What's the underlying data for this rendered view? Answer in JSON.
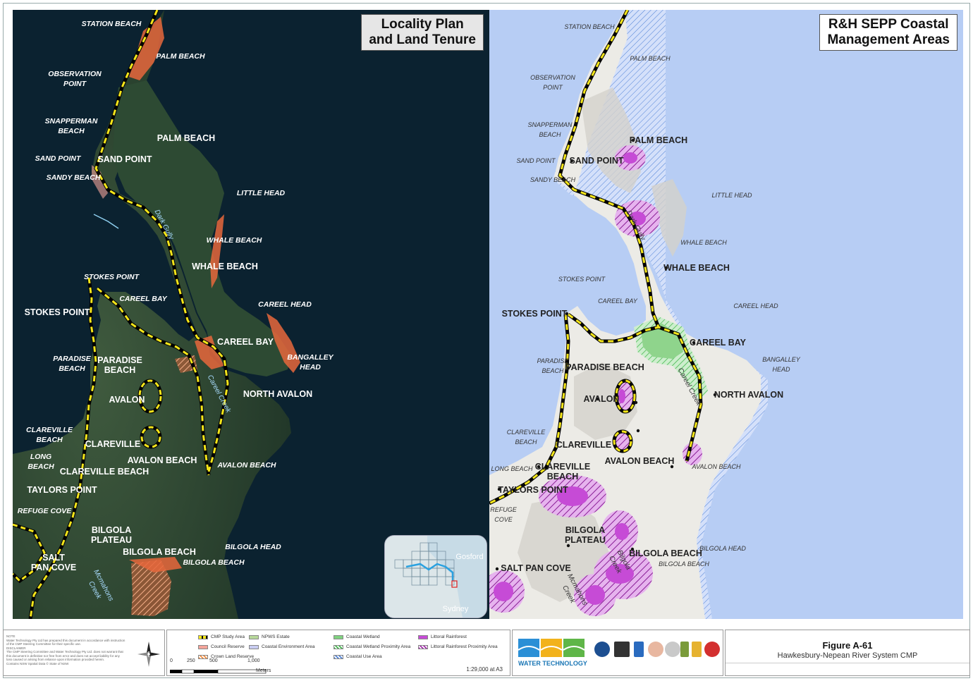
{
  "left_panel": {
    "title_line1": "Locality Plan",
    "title_line2": "and Land Tenure"
  },
  "right_panel": {
    "title_line1": "R&H SEPP Coastal",
    "title_line2": "Management Areas"
  },
  "labels": {
    "station_beach": "STATION BEACH",
    "palm_beach_beach": "PALM BEACH",
    "observation_point": "OBSERVATION\nPOINT",
    "snapperman_beach": "SNAPPERMAN\nBEACH",
    "palm_beach_locality": "PALM BEACH",
    "sand_point_beach": "SAND POINT",
    "sand_point_locality": "SAND POINT",
    "sandy_beach": "SANDY BEACH",
    "little_head": "LITTLE HEAD",
    "dark_gully": "Dark Gully",
    "whale_beach_beach": "WHALE BEACH",
    "whale_beach_locality": "WHALE BEACH",
    "stokes_point_small": "STOKES POINT",
    "careel_bay_small": "CAREEL BAY",
    "careel_head": "CAREEL HEAD",
    "stokes_point_locality": "STOKES POINT",
    "careel_bay_locality": "CAREEL BAY",
    "bangalley_head": "BANGALLEY\nHEAD",
    "paradise_beach_beach": "PARADISE\nBEACH",
    "paradise_beach_locality": "PARADISE\nBEACH",
    "paradise_beach_locality_right": "PARADISE BEACH",
    "careel_creek": "Careel Creek",
    "north_avalon": "NORTH AVALON",
    "avalon": "AVALON",
    "clareville_beach": "CLAREVILLE\nBEACH",
    "clareville_locality": "CLAREVILLE",
    "long_beach": "LONG\nBEACH",
    "long_beach_right": "LONG BEACH",
    "avalon_beach_locality": "AVALON BEACH",
    "avalon_beach_beach": "AVALON BEACH",
    "clareville_beach_locality": "CLAREVILLE BEACH",
    "clareville_beach_locality_right": "CLAREVILLE\nBEACH",
    "taylors_point": "TAYLORS POINT",
    "refuge_cove": "REFUGE COVE",
    "refuge_cove_right": "REFUGE\nCOVE",
    "bilgola_plateau": "BILGOLA\nPLATEAU",
    "bilgola_beach_locality": "BILGOLA BEACH",
    "bilgola_head": "BILGOLA HEAD",
    "bilgola_beach_beach": "BILGOLA BEACH",
    "salt_pan_cove": "SALT\nPAN COVE",
    "salt_pan_cove_right": "SALT PAN COVE",
    "mcmahons_creek": "Mcmahons\nCreek",
    "bilgola_creek": "Bilgola\nCreek"
  },
  "inset": {
    "gosford": "Gosford",
    "sydney": "Sydney"
  },
  "legend": {
    "items": [
      {
        "label": "CMP Study Area",
        "color": "#f5e61a",
        "style": "dashed"
      },
      {
        "label": "Council Reserve",
        "color": "#f4a49a",
        "style": "fill"
      },
      {
        "label": "Crown Land Reserve",
        "color": "#f08a3c",
        "style": "hatch"
      },
      {
        "label": "NPWS Estate",
        "color": "#b7d89a",
        "style": "fill"
      },
      {
        "label": "Coastal Environment Area",
        "color": "#c9cdf2",
        "style": "fill"
      },
      {
        "label": "Coastal Wetland",
        "color": "#7fd27f",
        "style": "fill"
      },
      {
        "label": "Coastal Wetland Proximity Area",
        "color": "#3fb64a",
        "style": "hatch"
      },
      {
        "label": "Coastal Use Area",
        "color": "#4c7fd6",
        "style": "hatch"
      },
      {
        "label": "Littoral Rainforest",
        "color": "#c64bd6",
        "style": "fill"
      },
      {
        "label": "Littoral Rainforest Proximity Area",
        "color": "#a02aa8",
        "style": "hatch"
      }
    ],
    "scale_ticks": [
      "0",
      "250",
      "500",
      "1,000"
    ],
    "scale_units": "Meters",
    "scale_ratio": "1:29,000 at A3"
  },
  "notes": {
    "note_heading": "NOTE",
    "note_text": "Water Technology Pty Ltd has prepared this document in accordance with instruction of the CMP Steering Committee for their specific use.",
    "disclaimer_heading": "DISCLAIMER",
    "disclaimer_text": "The CMP Steering Committee and Water Technology Pty Ltd. does not warrant that this document is definitive nor free from error and does not accept liability for any loss caused or arising from reliance upon information provided herein.",
    "contains": "Contains NSW Spatial Data © State of NSW"
  },
  "logos": {
    "water_technology": "WATER TECHNOLOGY"
  },
  "figure": {
    "title": "Figure A-61",
    "subtitle": "Hawkesbury-Nepean River System CMP"
  },
  "colors": {
    "ocean_dark": "#0b2230",
    "land_dark": "#213a2c",
    "ocean_light": "#b7cdf4",
    "land_light": "#ecebe6",
    "study_area": "#f5e61a",
    "crown_land": "#e8673c",
    "coastal_use": "#4c7fd6",
    "rainforest": "#c64bd6",
    "wetland": "#7fd27f"
  }
}
